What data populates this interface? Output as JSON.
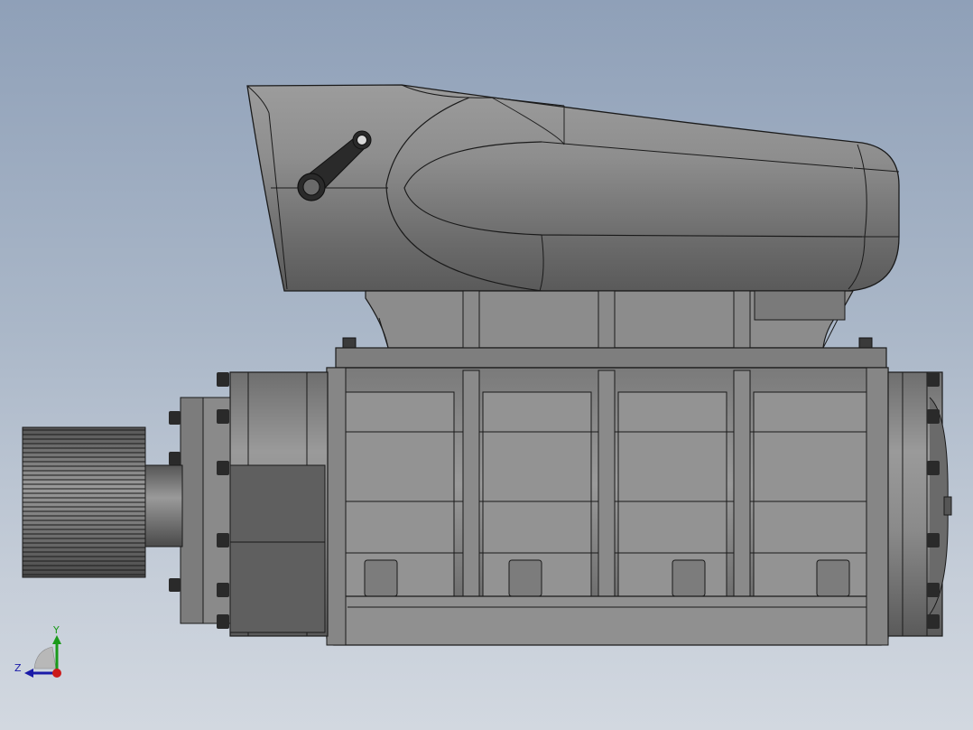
{
  "viewport": {
    "background_top": "#8fa0b8",
    "background_bottom": "#d2d8e0"
  },
  "model": {
    "body_color": "#8a8a8a",
    "edge_color": "#1a1a1a"
  },
  "triad": {
    "y_label": "Y",
    "z_label": "Z",
    "y_color": "#1a9a1a",
    "z_color": "#1a1aa8",
    "x_color": "#cc1a1a"
  }
}
